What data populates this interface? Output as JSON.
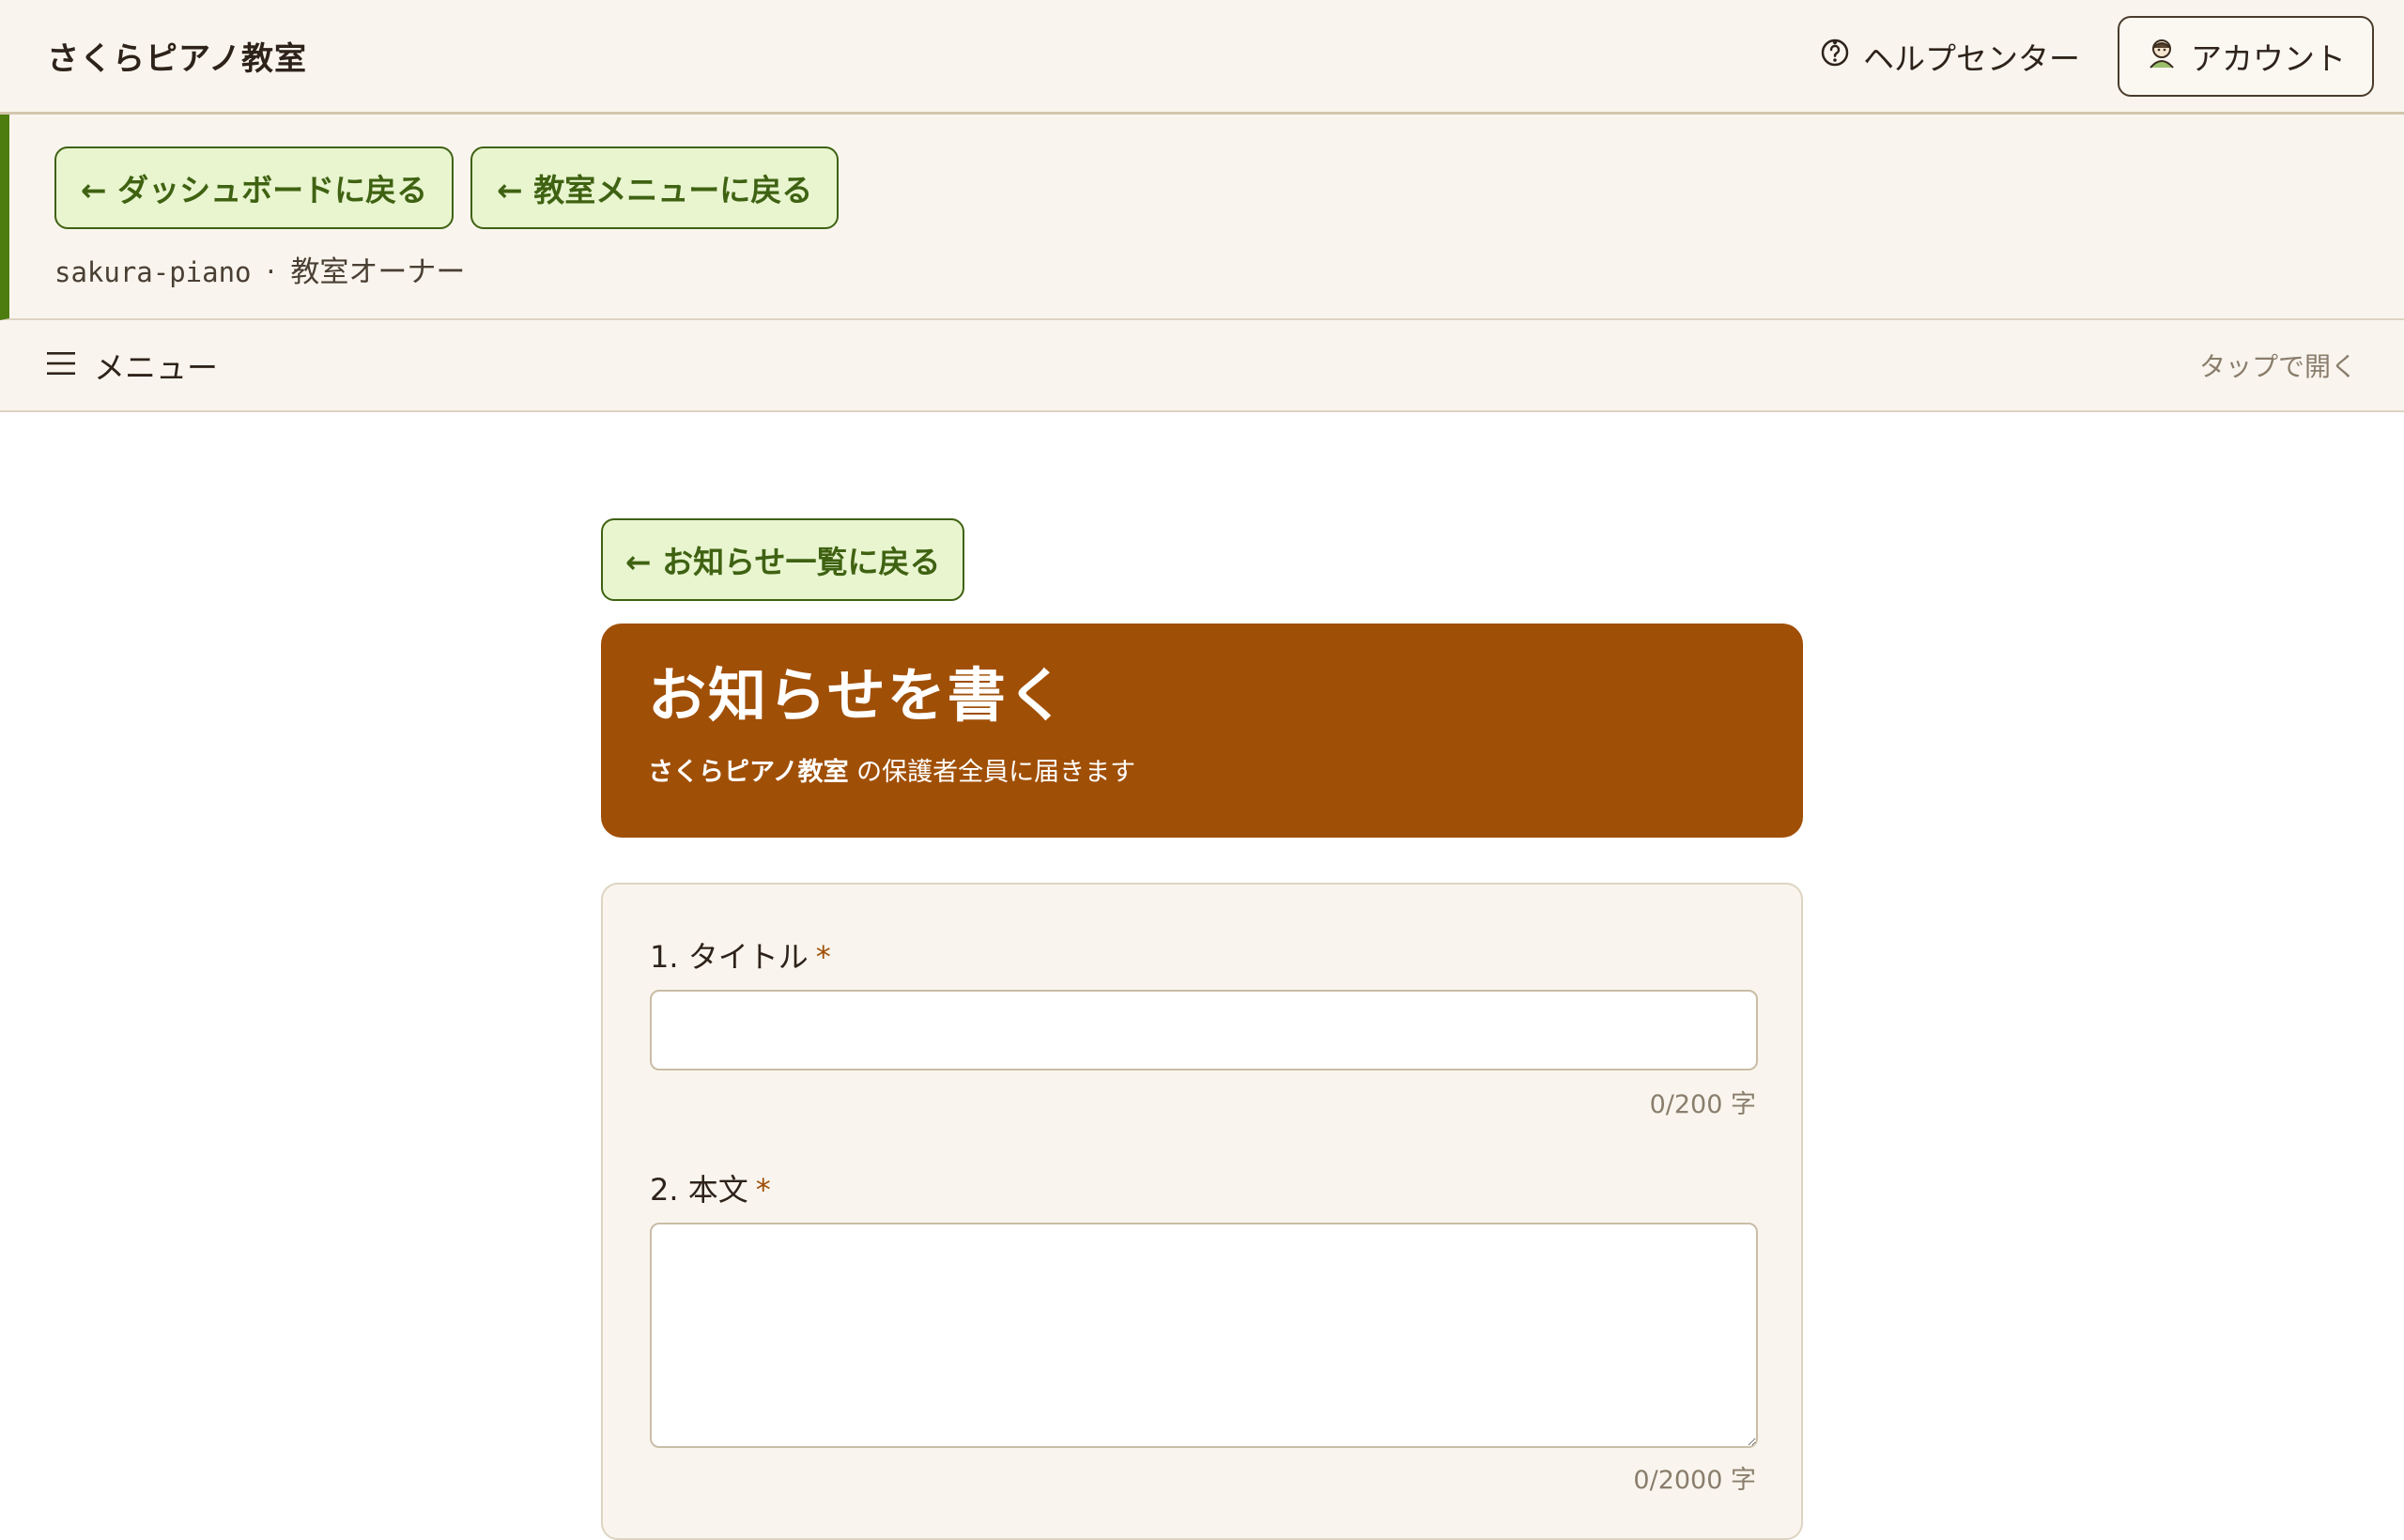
{
  "header": {
    "brand": "さくらピアノ教室",
    "help_label": "ヘルプセンター",
    "account_label": "アカウント"
  },
  "context": {
    "back_dashboard": "← ダッシュボードに戻る",
    "back_menu": "← 教室メニューに戻る",
    "slug": "sakura-piano",
    "separator": "·",
    "role": "教室オーナー"
  },
  "menubar": {
    "label": "メニュー",
    "hint": "タップで開く"
  },
  "main": {
    "back_list": "← お知らせ一覧に戻る",
    "title": "お知らせを書く",
    "subtitle_school": "さくらピアノ教室",
    "subtitle_rest": " の保護者全員に届きます"
  },
  "form": {
    "title_field": {
      "label": "1. タイトル",
      "required_mark": "*",
      "value": "",
      "counter": "0/200 字"
    },
    "body_field": {
      "label": "2. 本文",
      "required_mark": "*",
      "value": "",
      "counter": "0/2000 字"
    }
  },
  "icons": {
    "help": "help-circle-icon",
    "account": "user-avatar-icon",
    "menu": "hamburger-menu-icon"
  },
  "colors": {
    "accent_green": "#3f6212",
    "accent_green_bg": "#e8f5cf",
    "hero_brown": "#a04f06",
    "panel_bg": "#f9f5ee"
  }
}
